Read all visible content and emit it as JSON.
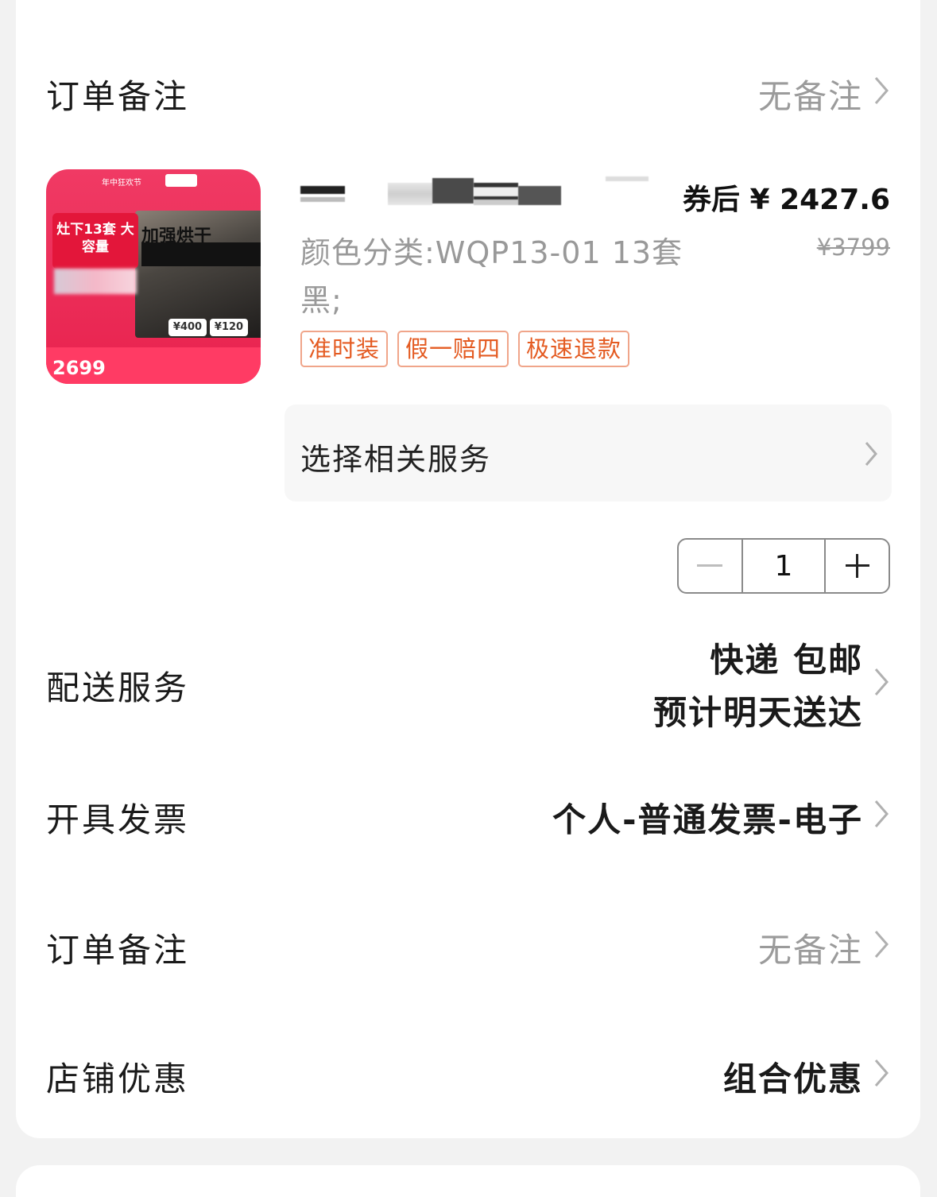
{
  "order_note_top": {
    "label": "订单备注",
    "value": "无备注"
  },
  "product": {
    "thumbnail": {
      "headline": "灶下13套 大容量",
      "feature": "加强烘干",
      "chip_left": "¥400",
      "chip_right": "¥120",
      "price": "2699",
      "top_tag": "年中狂欢节"
    },
    "price_after_coupon": "券后 ¥ 2427.6",
    "original_price": "¥3799",
    "variant": "颜色分类:WQP13-01 13套 黑;",
    "tags": [
      "准时装",
      "假一赔四",
      "极速退款"
    ],
    "service_label": "选择相关服务",
    "quantity": "1"
  },
  "delivery": {
    "label": "配送服务",
    "line1": "快递 包邮",
    "line2": "预计明天送达"
  },
  "invoice": {
    "label": "开具发票",
    "value": "个人-普通发票-电子"
  },
  "order_note": {
    "label": "订单备注",
    "value": "无备注"
  },
  "store_discount": {
    "label": "店铺优惠",
    "value": "组合优惠"
  },
  "icons": {
    "chevron": "chevron-right-icon",
    "minus": "minus-icon",
    "plus": "plus-icon"
  },
  "colors": {
    "tag_text": "#e45b22",
    "tag_border": "#f0a58a",
    "muted": "#9b9b9b",
    "thumb_bg": "#e8224e"
  }
}
